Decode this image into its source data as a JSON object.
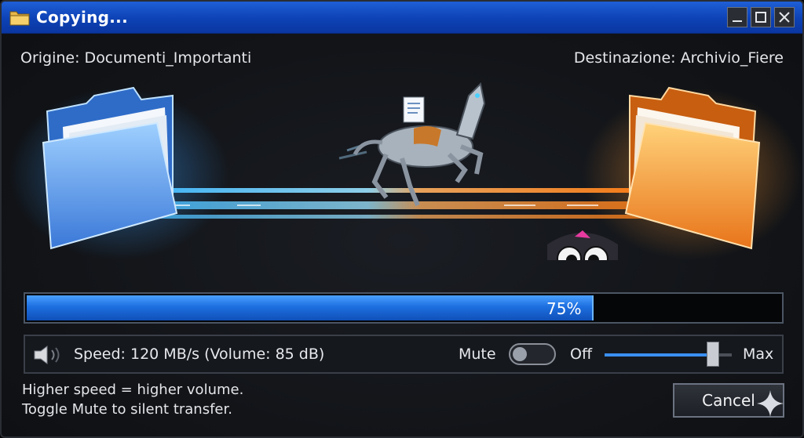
{
  "window": {
    "title": "Copying...",
    "icon": "folder-icon",
    "controls": [
      "minimize-icon",
      "maximize-icon",
      "close-icon"
    ]
  },
  "paths": {
    "origin": "Origine: Documenti_Importanti",
    "destination": "Destinazione: Archivio_Fiere"
  },
  "illustration": {
    "source_folder_icon": "blue-folder-icon",
    "destination_folder_icon": "orange-folder-icon",
    "carrier_icon": "robot-horse-icon",
    "mascot_icon": "owl-mascot-icon"
  },
  "progress": {
    "value": 0.75,
    "label": "75%"
  },
  "controls": {
    "speaker_icon": "speaker-icon",
    "speed_text": "Speed: 120 MB/s (Volume: 85 dB)",
    "mute_label": "Mute",
    "mute_state": "Off",
    "slider_max_label": "Max",
    "slider_level": 0.85
  },
  "help": {
    "line1": "Higher speed = higher volume.",
    "line2": "Toggle Mute to silent transfer."
  },
  "buttons": {
    "cancel": "Cancel"
  },
  "colors": {
    "titlebar": "#0d42b5",
    "progress": "#1d6fe0",
    "source_folder": "#5aa0f0",
    "destination_folder": "#f5a030"
  }
}
